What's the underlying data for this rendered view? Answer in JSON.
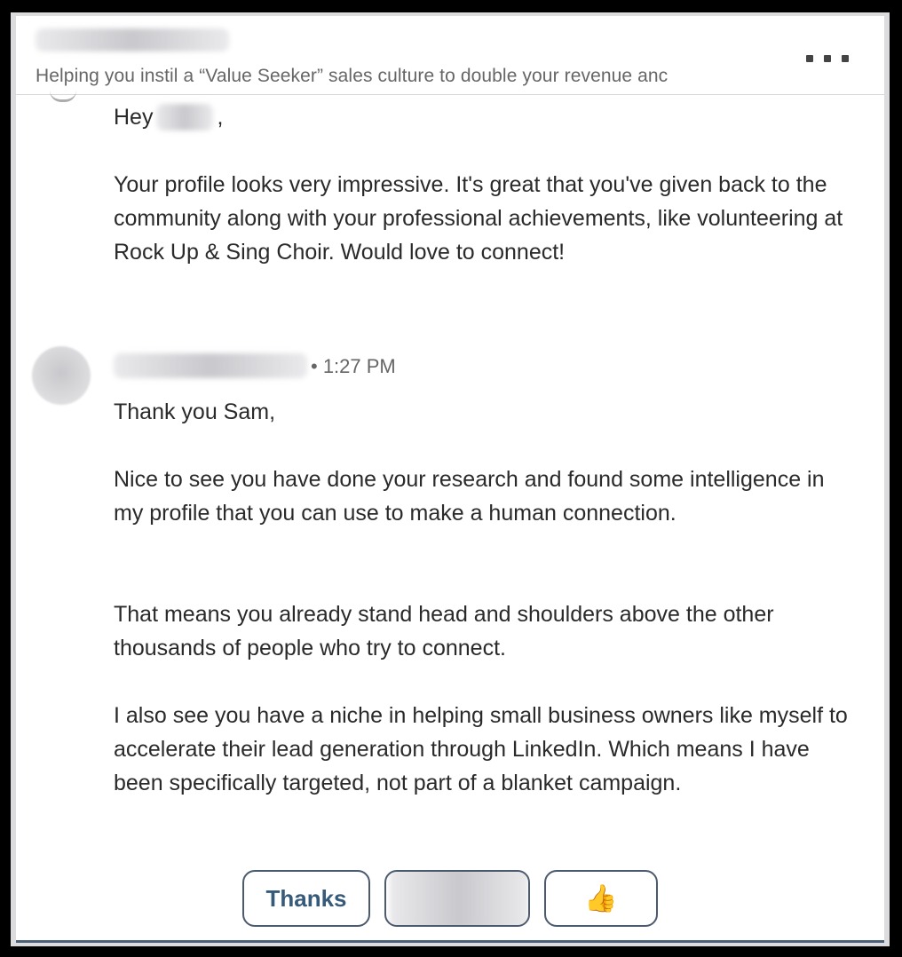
{
  "header": {
    "subtitle": "Helping you instil a “Value Seeker” sales culture to double your revenue anc"
  },
  "message1": {
    "greeting_prefix": "Hey",
    "greeting_suffix": ",",
    "body": "Your profile looks very impressive. It's great that you've given back to the community along with your professional achievements, like volunteering at Rock Up & Sing Choir. Would love to connect!"
  },
  "message2": {
    "timestamp": "• 1:27 PM",
    "greeting": "Thank you Sam,",
    "paragraphs": [
      "Nice to see you have done your research and found some intelligence in my profile that you can use to make a human connection.",
      "That means you already stand head and shoulders above the other thousands of people who try to connect.",
      "I also see you have a niche in helping small business owners like myself to accelerate their lead generation through LinkedIn. Which means I have been specifically targeted, not part of a blanket campaign."
    ]
  },
  "quick_replies": {
    "thanks": "Thanks",
    "thumbs_up": "👍"
  },
  "icons": {
    "more": "more-icon",
    "thumbs_up": "thumbs-up-icon"
  },
  "colors": {
    "button_border": "#4b5a6e",
    "button_text": "#365a79",
    "text": "#2a2a2a",
    "muted": "#666666"
  }
}
